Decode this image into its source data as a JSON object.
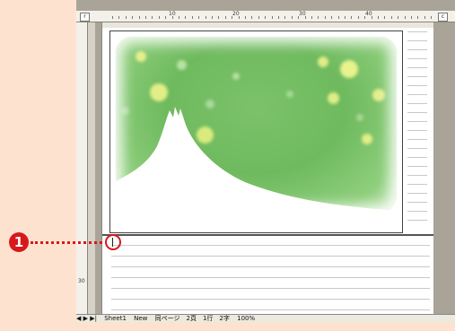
{
  "ruler": {
    "corner_left": "r",
    "corner_right": "c",
    "numbers": [
      "10",
      "20",
      "30",
      "40"
    ],
    "vertical_number": "30"
  },
  "callout": {
    "number": "1",
    "color": "#d7191c"
  },
  "statusbar": {
    "prefix": "◀ ▶ ▶|",
    "sheet": "Sheet1",
    "new_button": "New",
    "text": "同ページ　2頁　1行　2字",
    "zoom": "100%"
  },
  "colors": {
    "background": "#fde3cf",
    "photo_green": "#6fba5e",
    "app_gray": "#a9a497"
  }
}
